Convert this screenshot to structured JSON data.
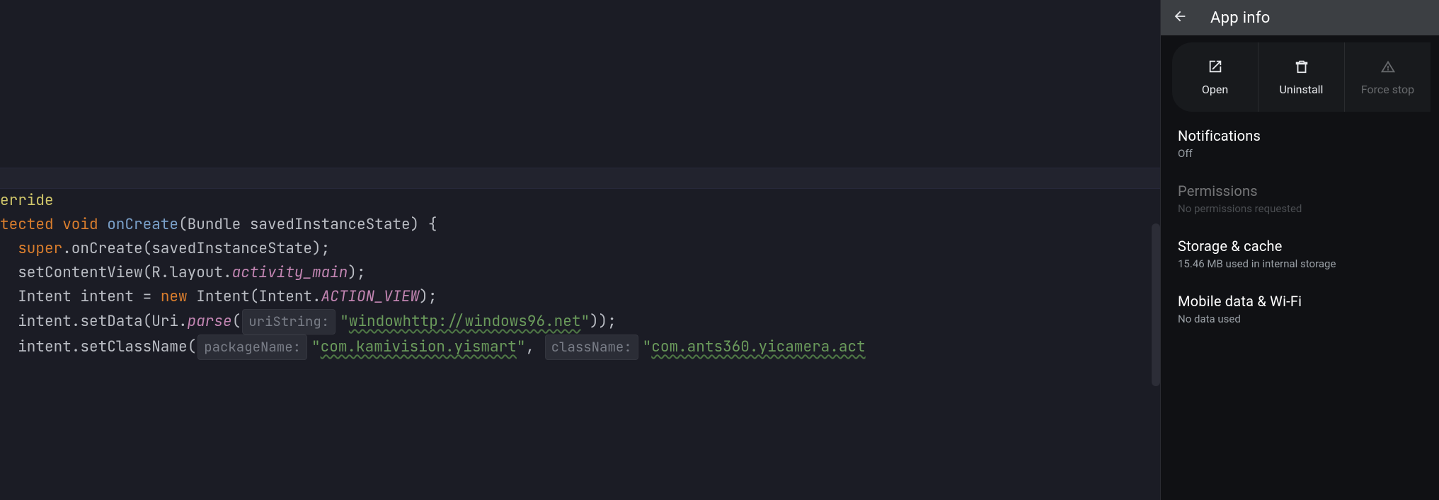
{
  "editor": {
    "lines": [
      {
        "tokens": [
          {
            "cls": "tok-ann",
            "t": "erride"
          }
        ]
      },
      {
        "tokens": [
          {
            "cls": "tok-kw",
            "t": "tected "
          },
          {
            "cls": "tok-kw",
            "t": "void "
          },
          {
            "cls": "tok-fn",
            "t": "onCreate"
          },
          {
            "cls": "tok-plain",
            "t": "(Bundle savedInstanceState) {"
          }
        ]
      },
      {
        "tokens": [
          {
            "cls": "tok-plain",
            "t": "  "
          },
          {
            "cls": "tok-kw",
            "t": "super"
          },
          {
            "cls": "tok-plain",
            "t": ".onCreate(savedInstanceState);"
          }
        ]
      },
      {
        "tokens": [
          {
            "cls": "tok-plain",
            "t": "  setContentView(R.layout."
          },
          {
            "cls": "tok-ital",
            "t": "activity_main"
          },
          {
            "cls": "tok-plain",
            "t": ");"
          }
        ]
      },
      {
        "tokens": [
          {
            "cls": "tok-plain",
            "t": ""
          }
        ]
      },
      {
        "tokens": [
          {
            "cls": "tok-plain",
            "t": "  Intent intent = "
          },
          {
            "cls": "tok-kw",
            "t": "new "
          },
          {
            "cls": "tok-plain",
            "t": "Intent(Intent."
          },
          {
            "cls": "tok-const",
            "t": "ACTION_VIEW"
          },
          {
            "cls": "tok-plain",
            "t": ");"
          }
        ]
      },
      {
        "tokens": [
          {
            "cls": "tok-plain",
            "t": "  intent.setData(Uri."
          },
          {
            "cls": "tok-ital",
            "t": "parse"
          },
          {
            "cls": "tok-plain",
            "t": "("
          },
          {
            "cls": "tok-hint",
            "t": "uriString:",
            "hint": true
          },
          {
            "cls": "tok-str",
            "t": "\""
          },
          {
            "cls": "tok-strlink",
            "t": "windowhttp://windows96.net"
          },
          {
            "cls": "tok-str",
            "t": "\""
          },
          {
            "cls": "tok-plain",
            "t": "));"
          }
        ]
      },
      {
        "tokens": [
          {
            "cls": "tok-plain",
            "t": "  intent.setClassName("
          },
          {
            "cls": "tok-hint",
            "t": "packageName:",
            "hint": true
          },
          {
            "cls": "tok-str",
            "t": "\""
          },
          {
            "cls": "tok-strlink",
            "t": "com.kamivision.yismart"
          },
          {
            "cls": "tok-str",
            "t": "\""
          },
          {
            "cls": "tok-plain",
            "t": ", "
          },
          {
            "cls": "tok-hint",
            "t": "className:",
            "hint": true
          },
          {
            "cls": "tok-str",
            "t": "\""
          },
          {
            "cls": "tok-strlink",
            "t": "com.ants360.yicamera.act"
          }
        ]
      }
    ]
  },
  "settings": {
    "header_title": "App info",
    "actions": {
      "open": "Open",
      "uninstall": "Uninstall",
      "forcestop": "Force stop"
    },
    "items": [
      {
        "title": "Notifications",
        "sub": "Off"
      },
      {
        "title": "Permissions",
        "sub": "No permissions requested",
        "disabled": true
      },
      {
        "title": "Storage & cache",
        "sub": "15.46 MB used in internal storage"
      },
      {
        "title": "Mobile data & Wi-Fi",
        "sub": "No data used"
      }
    ]
  }
}
